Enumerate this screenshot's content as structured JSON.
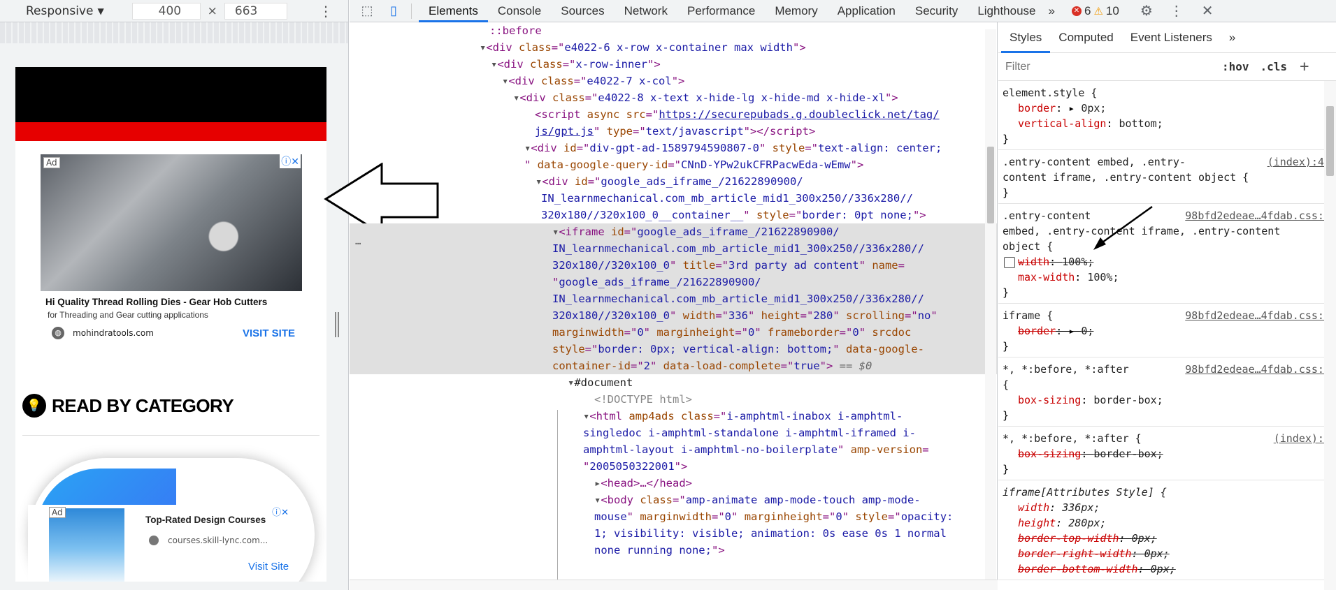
{
  "device_toolbar": {
    "mode": "Responsive",
    "width": "400",
    "times": "×",
    "height": "663"
  },
  "preview": {
    "ad1": {
      "badge": "Ad",
      "title": "Hi Quality Thread Rolling Dies - Gear Hob Cutters",
      "subtitle": "for Threading and Gear cutting applications",
      "domain": "mohindratools.com",
      "cta": "VISIT SITE"
    },
    "section_heading": "READ BY CATEGORY",
    "ad2": {
      "badge": "Ad",
      "title": "Top-Rated Design Courses",
      "domain": "courses.skill-lync.com...",
      "cta": "Visit Site"
    }
  },
  "tabs": [
    "Elements",
    "Console",
    "Sources",
    "Network",
    "Performance",
    "Memory",
    "Application",
    "Security",
    "Lighthouse"
  ],
  "tab_overflow": "»",
  "errors": "6",
  "warnings": "10",
  "elements": {
    "pseudo_before": "::before",
    "l1_class": "e4022-6 x-row x-container max width",
    "l2_class": "x-row-inner",
    "l3_class": "e4022-7 x-col",
    "l4_class": "e4022-8 x-text x-hide-lg x-hide-md x-hide-xl",
    "script_src_a": "https://securepubads.g.doubleclick.net/tag/",
    "script_src_b": "js/gpt.js",
    "script_type": "text/javascript",
    "gpt_id": "div-gpt-ad-1589794590807-0",
    "gpt_style": "text-align: center;",
    "gpt_query": "CNnD-YPw2ukCFRPacwEda-wEmw",
    "ads_div_id_a": "google_ads_iframe_/21622890900/",
    "ads_div_id_b": "IN_learnmechanical.com_mb_article_mid1_300x250//336x280//",
    "ads_div_id_c": "320x180//320x100_0__container__",
    "ads_div_style": "border: 0pt none;",
    "iframe_id_a": "google_ads_iframe_/21622890900/",
    "iframe_id_b": "IN_learnmechanical.com_mb_article_mid1_300x250//336x280//",
    "iframe_id_c": "320x180//320x100_0",
    "iframe_title": "3rd party ad content",
    "iframe_name_a": "google_ads_iframe_/21622890900/",
    "iframe_name_b": "IN_learnmechanical.com_mb_article_mid1_300x250//336x280//",
    "iframe_name_c": "320x180//320x100_0",
    "iframe_width": "336",
    "iframe_height": "280",
    "iframe_scrolling": "no",
    "iframe_mw": "0",
    "iframe_mh": "0",
    "iframe_fb": "0",
    "iframe_style": "border: 0px; vertical-align: bottom;",
    "iframe_container_id": "2",
    "iframe_load": "true",
    "dollar0": "== $0",
    "document": "#document",
    "doctype": "<!DOCTYPE html>",
    "html_class_a": "i-amphtml-inabox i-amphtml-",
    "html_class_b": "singledoc i-amphtml-standalone i-amphtml-iframed",
    "html_class_c": "i-",
    "html_class_d": "amphtml-layout i-amphtml-no-boilerplate",
    "amp_version": "2005050322001",
    "head": "<head>…</head>",
    "body_class_a": "amp-animate amp-mode-touch amp-mode-",
    "body_class_b": "mouse",
    "body_mw": "0",
    "body_mh": "0",
    "body_style_a": "opacity:",
    "body_style_b": "1; visibility: visible; animation: 0s ease 0s 1 normal",
    "body_style_c": "none running none;"
  },
  "styles": {
    "tabs": [
      "Styles",
      "Computed",
      "Event Listeners"
    ],
    "tabs_more": "»",
    "filter_placeholder": "Filter",
    "hov": ":hov",
    "cls": ".cls",
    "plus": "+",
    "rules": [
      {
        "selector": "element.style {",
        "source": ""
      },
      {
        "selector_a": ".entry-content embed, .entry-",
        "selector_b": "content iframe, .entry-content object {",
        "source": "(index):49"
      },
      {
        "selector_a": ".entry-content",
        "selector_b": "embed, .entry-content iframe, .entry-content",
        "selector_c": "object {",
        "source": "98bfd2edeae…4fdab.css:1"
      },
      {
        "selector": "iframe {",
        "source": "98bfd2edeae…4fdab.css:1"
      },
      {
        "selector": "*, *:before, *:after",
        "selector_b": "{",
        "source": "98bfd2edeae…4fdab.css:1"
      },
      {
        "selector": "*, *:before, *:after {",
        "source": "(index):1"
      },
      {
        "selector": "iframe[Attributes Style] {",
        "source": ""
      }
    ],
    "decl": {
      "border": "border",
      "border_val": "0px;",
      "valign": "vertical-align",
      "valign_val": "bottom;",
      "width": "width",
      "width_val": "100%;",
      "maxw": "max-width",
      "maxw_val": "100%;",
      "iframe_border": "border",
      "iframe_border_val": "0;",
      "bs": "box-sizing",
      "bs_val": "border-box;",
      "bs2": "box-sizing",
      "bs2_val": "border-box;",
      "aw": "width",
      "aw_val": "336px;",
      "ah": "height",
      "ah_val": "280px;",
      "btw": "border-top-width",
      "btw_val": "0px;",
      "brw": "border-right-width",
      "brw_val": "0px;",
      "bbw": "border-bottom-width",
      "bbw_val": "0px;"
    },
    "closing": "}"
  }
}
